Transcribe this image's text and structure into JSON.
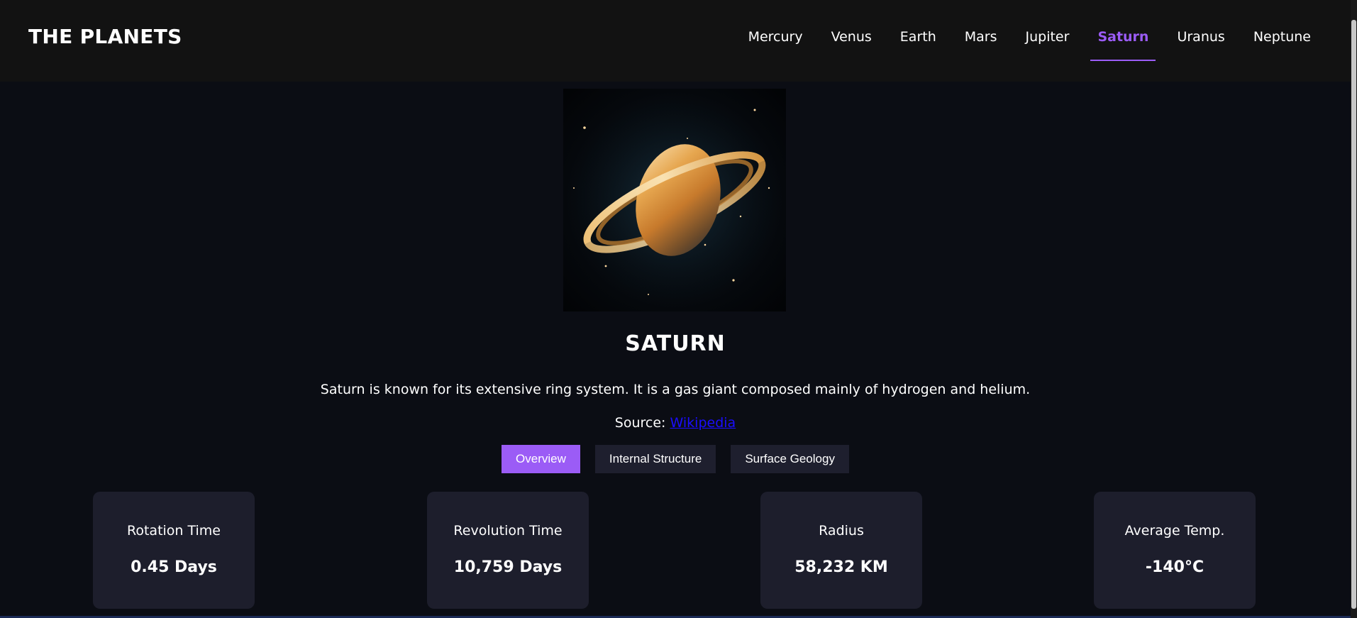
{
  "header": {
    "logo": "THE PLANETS",
    "nav": [
      {
        "label": "Mercury",
        "active": false
      },
      {
        "label": "Venus",
        "active": false
      },
      {
        "label": "Earth",
        "active": false
      },
      {
        "label": "Mars",
        "active": false
      },
      {
        "label": "Jupiter",
        "active": false
      },
      {
        "label": "Saturn",
        "active": true
      },
      {
        "label": "Uranus",
        "active": false
      },
      {
        "label": "Neptune",
        "active": false
      }
    ]
  },
  "planet": {
    "image_icon": "saturn-image",
    "name": "SATURN",
    "description": "Saturn is known for its extensive ring system. It is a gas giant composed mainly of hydrogen and helium.",
    "source_label": "Source:",
    "source_link": "Wikipedia"
  },
  "tabs": [
    {
      "label": "Overview",
      "active": true
    },
    {
      "label": "Internal Structure",
      "active": false
    },
    {
      "label": "Surface Geology",
      "active": false
    }
  ],
  "stats": [
    {
      "label": "Rotation Time",
      "value": "0.45 Days"
    },
    {
      "label": "Revolution Time",
      "value": "10,759 Days"
    },
    {
      "label": "Radius",
      "value": "58,232 KM"
    },
    {
      "label": "Average Temp.",
      "value": "-140°C"
    }
  ],
  "colors": {
    "accent": "#9b5cf6",
    "background": "#0b0d14",
    "header_bg": "#121212",
    "card_bg": "#1d1e2c",
    "link": "#1a0dff"
  }
}
